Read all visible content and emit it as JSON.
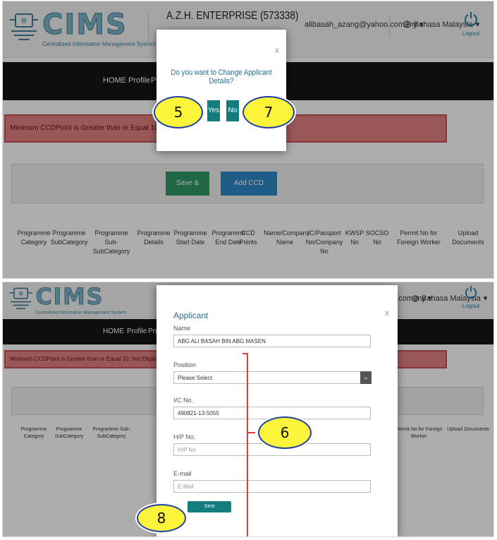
{
  "app": {
    "logo_text": "CIMS",
    "logo_subtitle": "Centralized Information Management System",
    "company": "A.Z.H. ENTERPRISE (573338)",
    "user_email": "alibasah_azang@yahoo.com.my",
    "language": "Bahasa Malaysia",
    "logout": "Logout"
  },
  "nav": {
    "home": "HOME",
    "profile": "Profile",
    "programme": "Pro"
  },
  "alert_text": "Minimum CCDPoint is Greater than or Equal 10. Not Eligible to Con",
  "buttons": {
    "save_continue": "Save & Continue",
    "add_ccd": "Add CCD Programme"
  },
  "table_headers": [
    "Programme Category",
    "Programme SubCategory",
    "Programme Sub-SubCategory",
    "Programme Details",
    "Programme Start Date",
    "Programme End Date",
    "CCD Points",
    "Name/Company Name",
    "IC/Passport No/Company No",
    "KWSP No",
    "SOCSO No",
    "Permit No for Foreign Worker",
    "Upload Documents"
  ],
  "confirm_dialog": {
    "close": "x",
    "message": "Do you want to Change Applicant Details?",
    "yes": "Yes",
    "no": "No"
  },
  "applicant_form": {
    "close": "x",
    "title": "Applicant",
    "name_label": "Name",
    "name_value": "ABG ALI BASAH BIN ABG MASEN",
    "position_label": "Position",
    "position_value": "Please Select",
    "ic_label": "I/C No.",
    "ic_value": "490821-13-5055",
    "hp_label": "H/P No.",
    "hp_placeholder": "H/P No",
    "email_label": "E-mail",
    "email_placeholder": "E-Mail",
    "submit": "Sent"
  },
  "callouts": {
    "c5": "5",
    "c7": "7",
    "c6": "6",
    "c8": "8"
  },
  "colors": {
    "teal": "#147c7c",
    "green": "#2f9866",
    "blue": "#2e89c6",
    "alert": "#e48080",
    "nav": "#151515",
    "callout": "#fbf43a"
  },
  "icons": [
    "cims-logo-icon",
    "globe-icon",
    "power-icon",
    "chevron-down-icon"
  ]
}
